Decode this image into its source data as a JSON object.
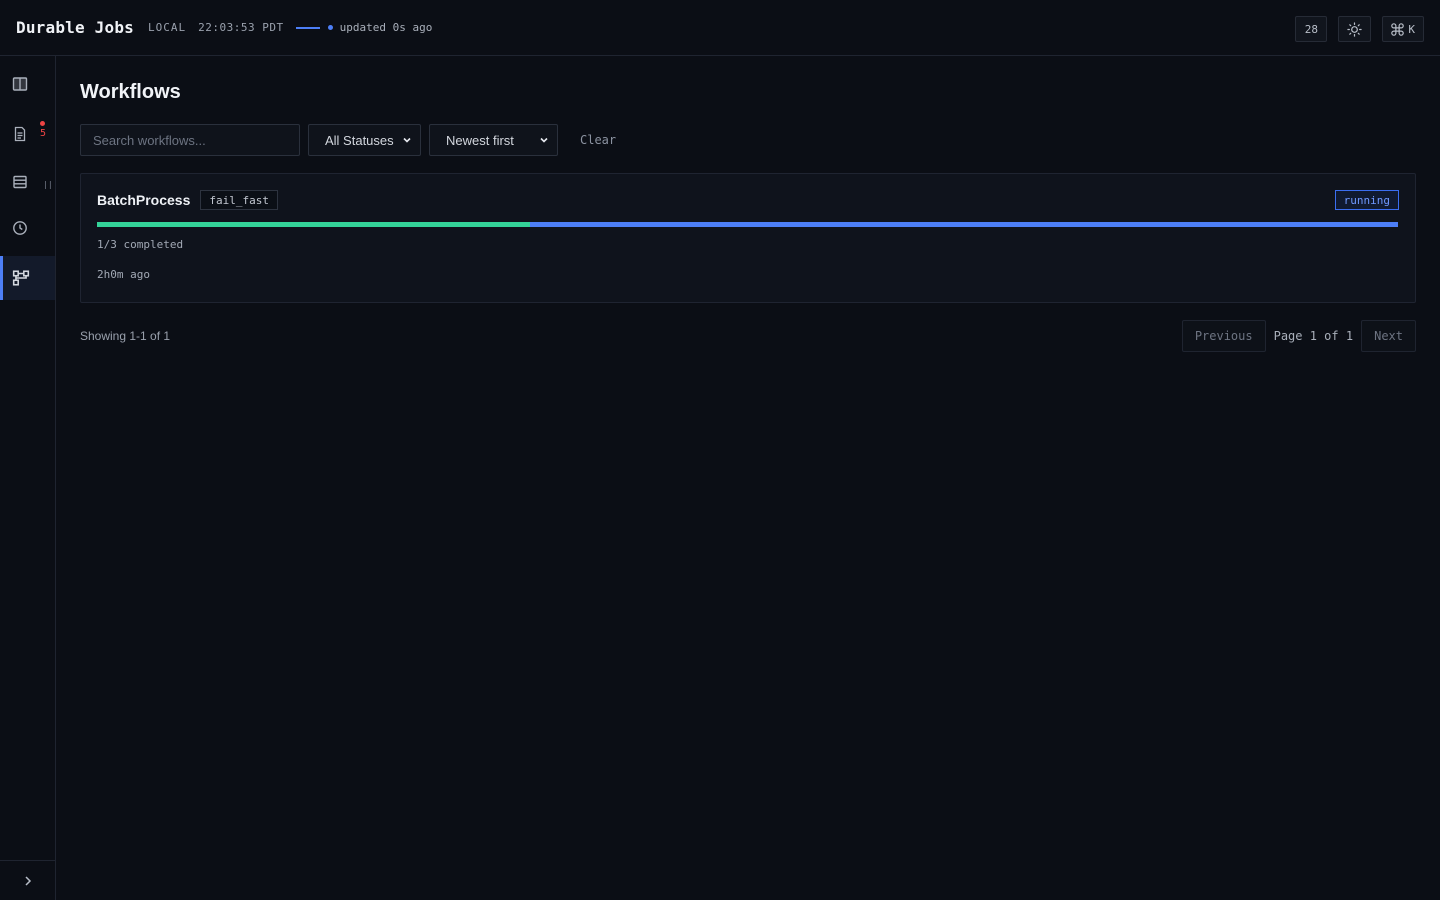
{
  "header": {
    "app_title": "Durable Jobs",
    "environment": "LOCAL",
    "clock": "22:03:53 PDT",
    "updated_text": "updated 0s ago",
    "counter_label": "28",
    "shortcut_label": "K",
    "accent_color": "#4d7ff7"
  },
  "sidebar": {
    "items": [
      {
        "icon": "book-icon"
      },
      {
        "icon": "document-icon",
        "badge_count": "5"
      },
      {
        "icon": "list-icon"
      },
      {
        "icon": "clock-icon"
      },
      {
        "icon": "workflow-icon",
        "active": true
      }
    ],
    "expand_icon": "chevron-right-icon"
  },
  "main": {
    "page_title": "Workflows",
    "search_placeholder": "Search workflows...",
    "status_filter": "All Statuses",
    "sort_order": "Newest first",
    "clear_label": "Clear"
  },
  "workflows": [
    {
      "name": "BatchProcess",
      "tag": "fail_fast",
      "status": "running",
      "completed_text": "1/3 completed",
      "progress": 0.333,
      "age": "2h0m ago"
    }
  ],
  "pagination": {
    "showing": "Showing 1-1 of 1",
    "previous_label": "Previous",
    "page_info": "Page 1 of 1",
    "next_label": "Next"
  }
}
